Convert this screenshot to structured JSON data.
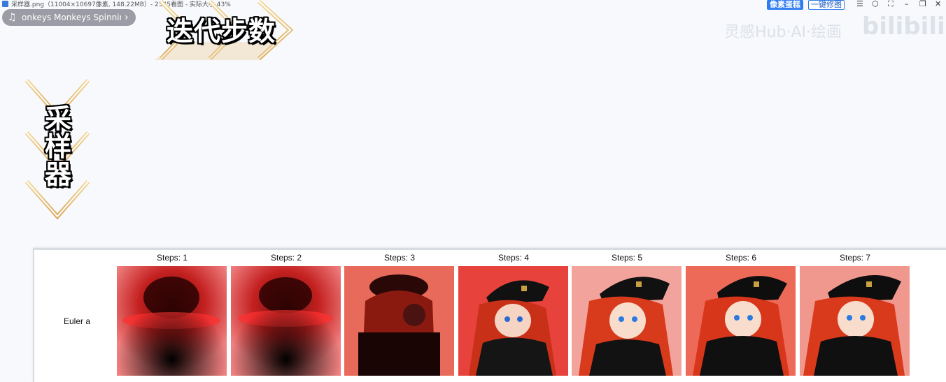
{
  "window": {
    "file_title": "采样器.png（11004×10697像素, 148.22MB）- 2345看图 - 实际大小 43%",
    "btn_pixel": "像素蛋糕",
    "btn_fix": "一键修图",
    "controls": [
      "☰",
      "⬡",
      "⛶",
      "–",
      "❐",
      "✕"
    ]
  },
  "music": {
    "note_icon": "music-note-icon",
    "track": "onkeys   Monkeys Spinning Monkeys",
    "chevron": "›"
  },
  "banners": {
    "horizontal": "迭代步数",
    "vertical": "采样器"
  },
  "watermark": {
    "text": "灵感Hub·AI·绘画",
    "logo": "bilibili"
  },
  "grid": {
    "row_label": "Euler a",
    "columns": [
      {
        "label": "Steps: 1"
      },
      {
        "label": "Steps: 2"
      },
      {
        "label": "Steps: 3"
      },
      {
        "label": "Steps: 4"
      },
      {
        "label": "Steps: 5"
      },
      {
        "label": "Steps: 6"
      },
      {
        "label": "Steps: 7"
      },
      {
        "label": ""
      }
    ]
  },
  "colors": {
    "accent_blue": "#2d7bf0",
    "banner_gold": "#e8c27a",
    "image_red": "#e8423c"
  }
}
